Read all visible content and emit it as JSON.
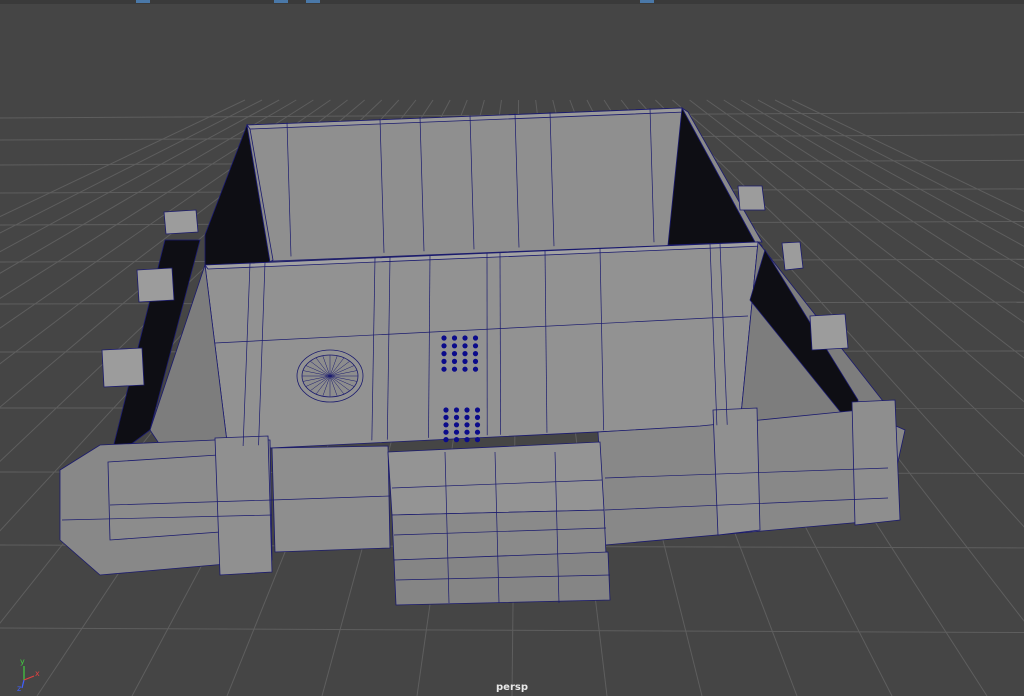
{
  "viewport": {
    "camera_label": "persp",
    "background": "#454545",
    "grid_color": "#5e5e5e",
    "wire_color": "#1a1a6e",
    "mesh_color": "#8e8e8e",
    "selection_color": "#0b0b8a"
  },
  "axis_gizmo": {
    "x_label": "x",
    "y_label": "y",
    "z_label": "z",
    "x_color": "#e04040",
    "y_color": "#40d040",
    "z_color": "#4060ff"
  }
}
